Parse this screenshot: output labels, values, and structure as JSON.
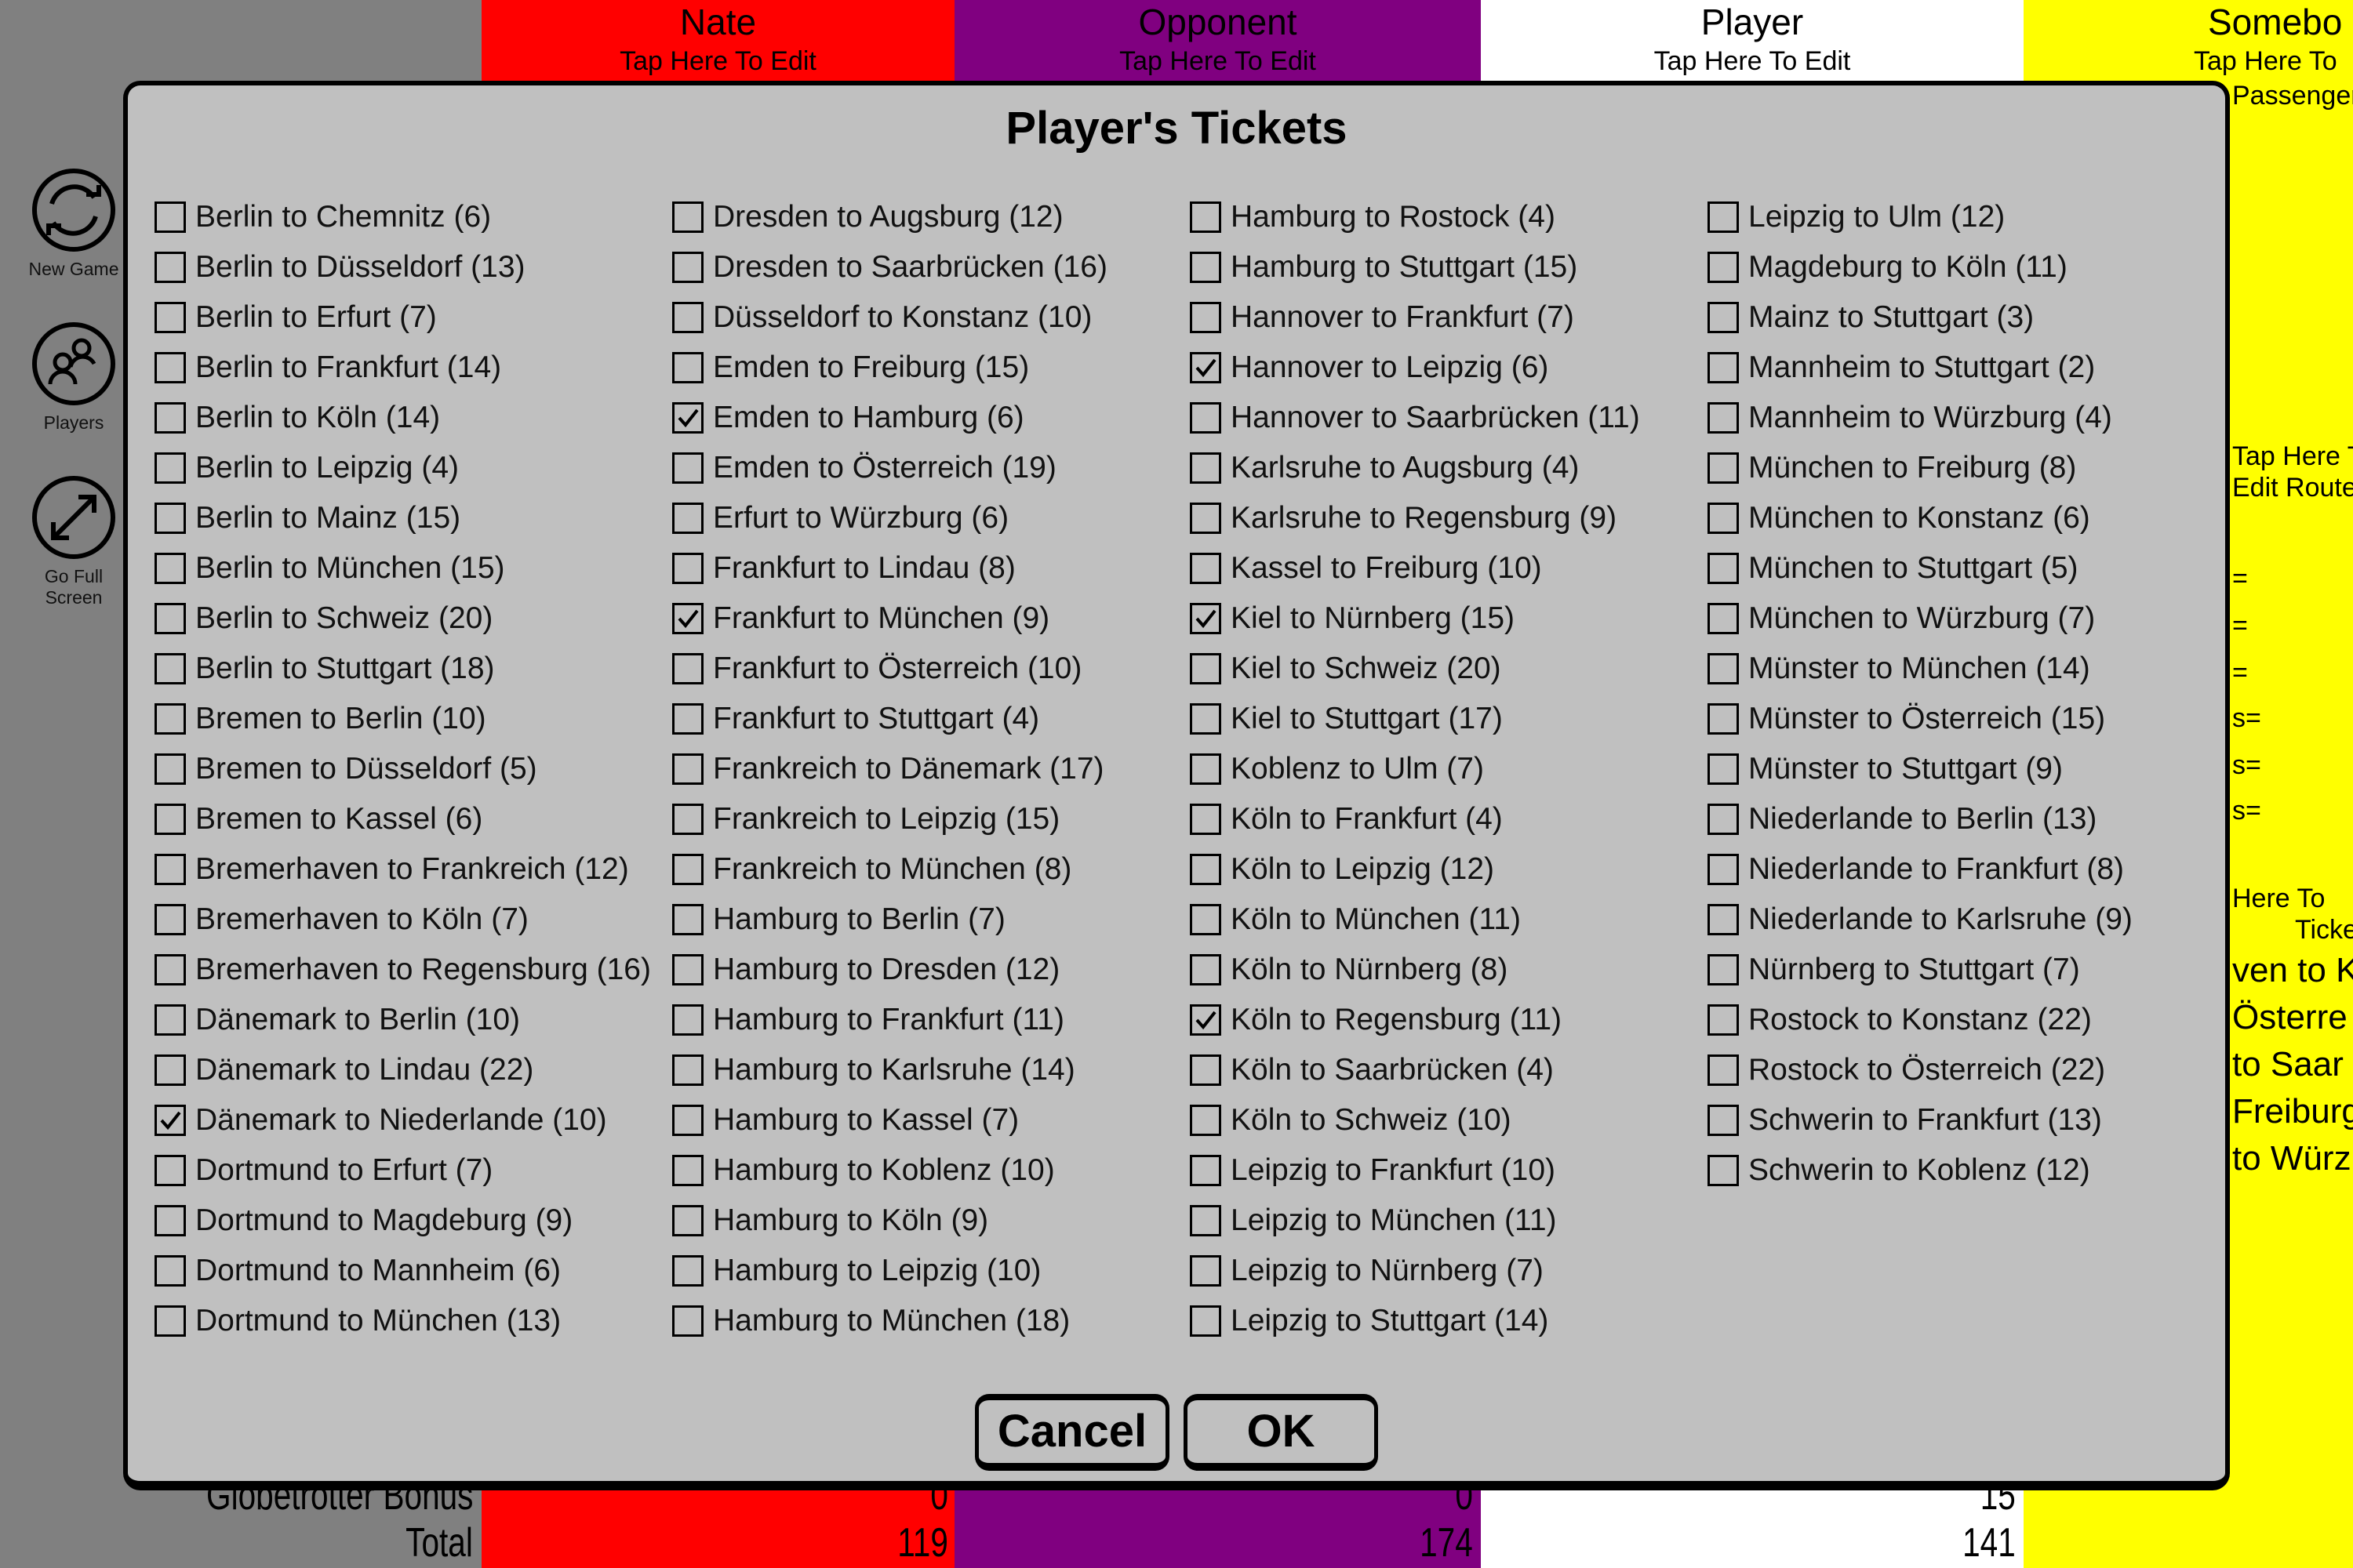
{
  "sidebar": {
    "items": [
      {
        "label": "New Game",
        "icon": "refresh-icon"
      },
      {
        "label": "Players",
        "icon": "players-icon"
      },
      {
        "label": "Go Full Screen",
        "icon": "fullscreen-icon"
      }
    ]
  },
  "players": [
    {
      "name": "Nate",
      "edit": "Tap Here To Edit",
      "color": "#ff0000",
      "globetrotter": "0",
      "total": "119"
    },
    {
      "name": "Opponent",
      "edit": "Tap Here To Edit",
      "color": "#800080",
      "globetrotter": "0",
      "total": "174"
    },
    {
      "name": "Player",
      "edit": "Tap Here To Edit",
      "color": "#ffffff",
      "globetrotter": "15",
      "total": "141"
    },
    {
      "name": "Somebo",
      "edit": "Tap Here To",
      "color": "#ffff00",
      "globetrotter": "",
      "total": ""
    }
  ],
  "yellow_fragments": [
    "Passenger",
    "Tap Here T",
    "Edit Route",
    "=",
    "=",
    "=",
    "s=",
    "s=",
    "s=",
    "Here To",
    "Tickets",
    "ven to K",
    "Österre",
    "to Saar",
    "Freiburg",
    "to Würz"
  ],
  "score_labels": {
    "globetrotter": "Globetrotter Bonus",
    "total": "Total"
  },
  "dialog": {
    "title": "Player's Tickets",
    "cancel_label": "Cancel",
    "ok_label": "OK",
    "columns": [
      [
        {
          "label": "Berlin to Chemnitz (6)",
          "checked": false
        },
        {
          "label": "Berlin to Düsseldorf (13)",
          "checked": false
        },
        {
          "label": "Berlin to Erfurt (7)",
          "checked": false
        },
        {
          "label": "Berlin to Frankfurt (14)",
          "checked": false
        },
        {
          "label": "Berlin to Köln (14)",
          "checked": false
        },
        {
          "label": "Berlin to Leipzig (4)",
          "checked": false
        },
        {
          "label": "Berlin to Mainz (15)",
          "checked": false
        },
        {
          "label": "Berlin to München (15)",
          "checked": false
        },
        {
          "label": "Berlin to Schweiz (20)",
          "checked": false
        },
        {
          "label": "Berlin to Stuttgart (18)",
          "checked": false
        },
        {
          "label": "Bremen to Berlin (10)",
          "checked": false
        },
        {
          "label": "Bremen to Düsseldorf (5)",
          "checked": false
        },
        {
          "label": "Bremen to Kassel (6)",
          "checked": false
        },
        {
          "label": "Bremerhaven to Frankreich (12)",
          "checked": false
        },
        {
          "label": "Bremerhaven to Köln (7)",
          "checked": false
        },
        {
          "label": "Bremerhaven to Regensburg (16)",
          "checked": false
        },
        {
          "label": "Dänemark to Berlin (10)",
          "checked": false
        },
        {
          "label": "Dänemark to Lindau (22)",
          "checked": false
        },
        {
          "label": "Dänemark to Niederlande (10)",
          "checked": true
        },
        {
          "label": "Dortmund to Erfurt (7)",
          "checked": false
        },
        {
          "label": "Dortmund to Magdeburg (9)",
          "checked": false
        },
        {
          "label": "Dortmund to Mannheim (6)",
          "checked": false
        },
        {
          "label": "Dortmund to München (13)",
          "checked": false
        }
      ],
      [
        {
          "label": "Dresden to Augsburg (12)",
          "checked": false
        },
        {
          "label": "Dresden to Saarbrücken (16)",
          "checked": false
        },
        {
          "label": "Düsseldorf to Konstanz (10)",
          "checked": false
        },
        {
          "label": "Emden to Freiburg (15)",
          "checked": false
        },
        {
          "label": "Emden to Hamburg (6)",
          "checked": true
        },
        {
          "label": "Emden to Österreich (19)",
          "checked": false
        },
        {
          "label": "Erfurt to Würzburg (6)",
          "checked": false
        },
        {
          "label": "Frankfurt to Lindau (8)",
          "checked": false
        },
        {
          "label": "Frankfurt to München (9)",
          "checked": true
        },
        {
          "label": "Frankfurt to Österreich (10)",
          "checked": false
        },
        {
          "label": "Frankfurt to Stuttgart (4)",
          "checked": false
        },
        {
          "label": "Frankreich to Dänemark (17)",
          "checked": false
        },
        {
          "label": "Frankreich to Leipzig (15)",
          "checked": false
        },
        {
          "label": "Frankreich to München (8)",
          "checked": false
        },
        {
          "label": "Hamburg to Berlin (7)",
          "checked": false
        },
        {
          "label": "Hamburg to Dresden (12)",
          "checked": false
        },
        {
          "label": "Hamburg to Frankfurt (11)",
          "checked": false
        },
        {
          "label": "Hamburg to Karlsruhe (14)",
          "checked": false
        },
        {
          "label": "Hamburg to Kassel (7)",
          "checked": false
        },
        {
          "label": "Hamburg to Koblenz (10)",
          "checked": false
        },
        {
          "label": "Hamburg to Köln (9)",
          "checked": false
        },
        {
          "label": "Hamburg to Leipzig (10)",
          "checked": false
        },
        {
          "label": "Hamburg to München (18)",
          "checked": false
        }
      ],
      [
        {
          "label": "Hamburg to Rostock (4)",
          "checked": false
        },
        {
          "label": "Hamburg to Stuttgart (15)",
          "checked": false
        },
        {
          "label": "Hannover to Frankfurt (7)",
          "checked": false
        },
        {
          "label": "Hannover to Leipzig (6)",
          "checked": true
        },
        {
          "label": "Hannover to Saarbrücken (11)",
          "checked": false
        },
        {
          "label": "Karlsruhe to Augsburg (4)",
          "checked": false
        },
        {
          "label": "Karlsruhe to Regensburg (9)",
          "checked": false
        },
        {
          "label": "Kassel to Freiburg (10)",
          "checked": false
        },
        {
          "label": "Kiel to Nürnberg (15)",
          "checked": true
        },
        {
          "label": "Kiel to Schweiz (20)",
          "checked": false
        },
        {
          "label": "Kiel to Stuttgart (17)",
          "checked": false
        },
        {
          "label": "Koblenz to Ulm (7)",
          "checked": false
        },
        {
          "label": "Köln to Frankfurt (4)",
          "checked": false
        },
        {
          "label": "Köln to Leipzig (12)",
          "checked": false
        },
        {
          "label": "Köln to München (11)",
          "checked": false
        },
        {
          "label": "Köln to Nürnberg (8)",
          "checked": false
        },
        {
          "label": "Köln to Regensburg (11)",
          "checked": true
        },
        {
          "label": "Köln to Saarbrücken (4)",
          "checked": false
        },
        {
          "label": "Köln to Schweiz (10)",
          "checked": false
        },
        {
          "label": "Leipzig to Frankfurt (10)",
          "checked": false
        },
        {
          "label": "Leipzig to München (11)",
          "checked": false
        },
        {
          "label": "Leipzig to Nürnberg (7)",
          "checked": false
        },
        {
          "label": "Leipzig to Stuttgart (14)",
          "checked": false
        }
      ],
      [
        {
          "label": "Leipzig to Ulm (12)",
          "checked": false
        },
        {
          "label": "Magdeburg to Köln (11)",
          "checked": false
        },
        {
          "label": "Mainz to Stuttgart (3)",
          "checked": false
        },
        {
          "label": "Mannheim to Stuttgart (2)",
          "checked": false
        },
        {
          "label": "Mannheim to Würzburg (4)",
          "checked": false
        },
        {
          "label": "München to Freiburg (8)",
          "checked": false
        },
        {
          "label": "München to Konstanz (6)",
          "checked": false
        },
        {
          "label": "München to Stuttgart (5)",
          "checked": false
        },
        {
          "label": "München to Würzburg (7)",
          "checked": false
        },
        {
          "label": "Münster to München (14)",
          "checked": false
        },
        {
          "label": "Münster to Österreich (15)",
          "checked": false
        },
        {
          "label": "Münster to Stuttgart (9)",
          "checked": false
        },
        {
          "label": "Niederlande to Berlin (13)",
          "checked": false
        },
        {
          "label": "Niederlande to Frankfurt (8)",
          "checked": false
        },
        {
          "label": "Niederlande to Karlsruhe (9)",
          "checked": false
        },
        {
          "label": "Nürnberg to Stuttgart (7)",
          "checked": false
        },
        {
          "label": "Rostock to Konstanz (22)",
          "checked": false
        },
        {
          "label": "Rostock to Österreich (22)",
          "checked": false
        },
        {
          "label": "Schwerin to Frankfurt (13)",
          "checked": false
        },
        {
          "label": "Schwerin to Koblenz (12)",
          "checked": false
        }
      ]
    ]
  }
}
